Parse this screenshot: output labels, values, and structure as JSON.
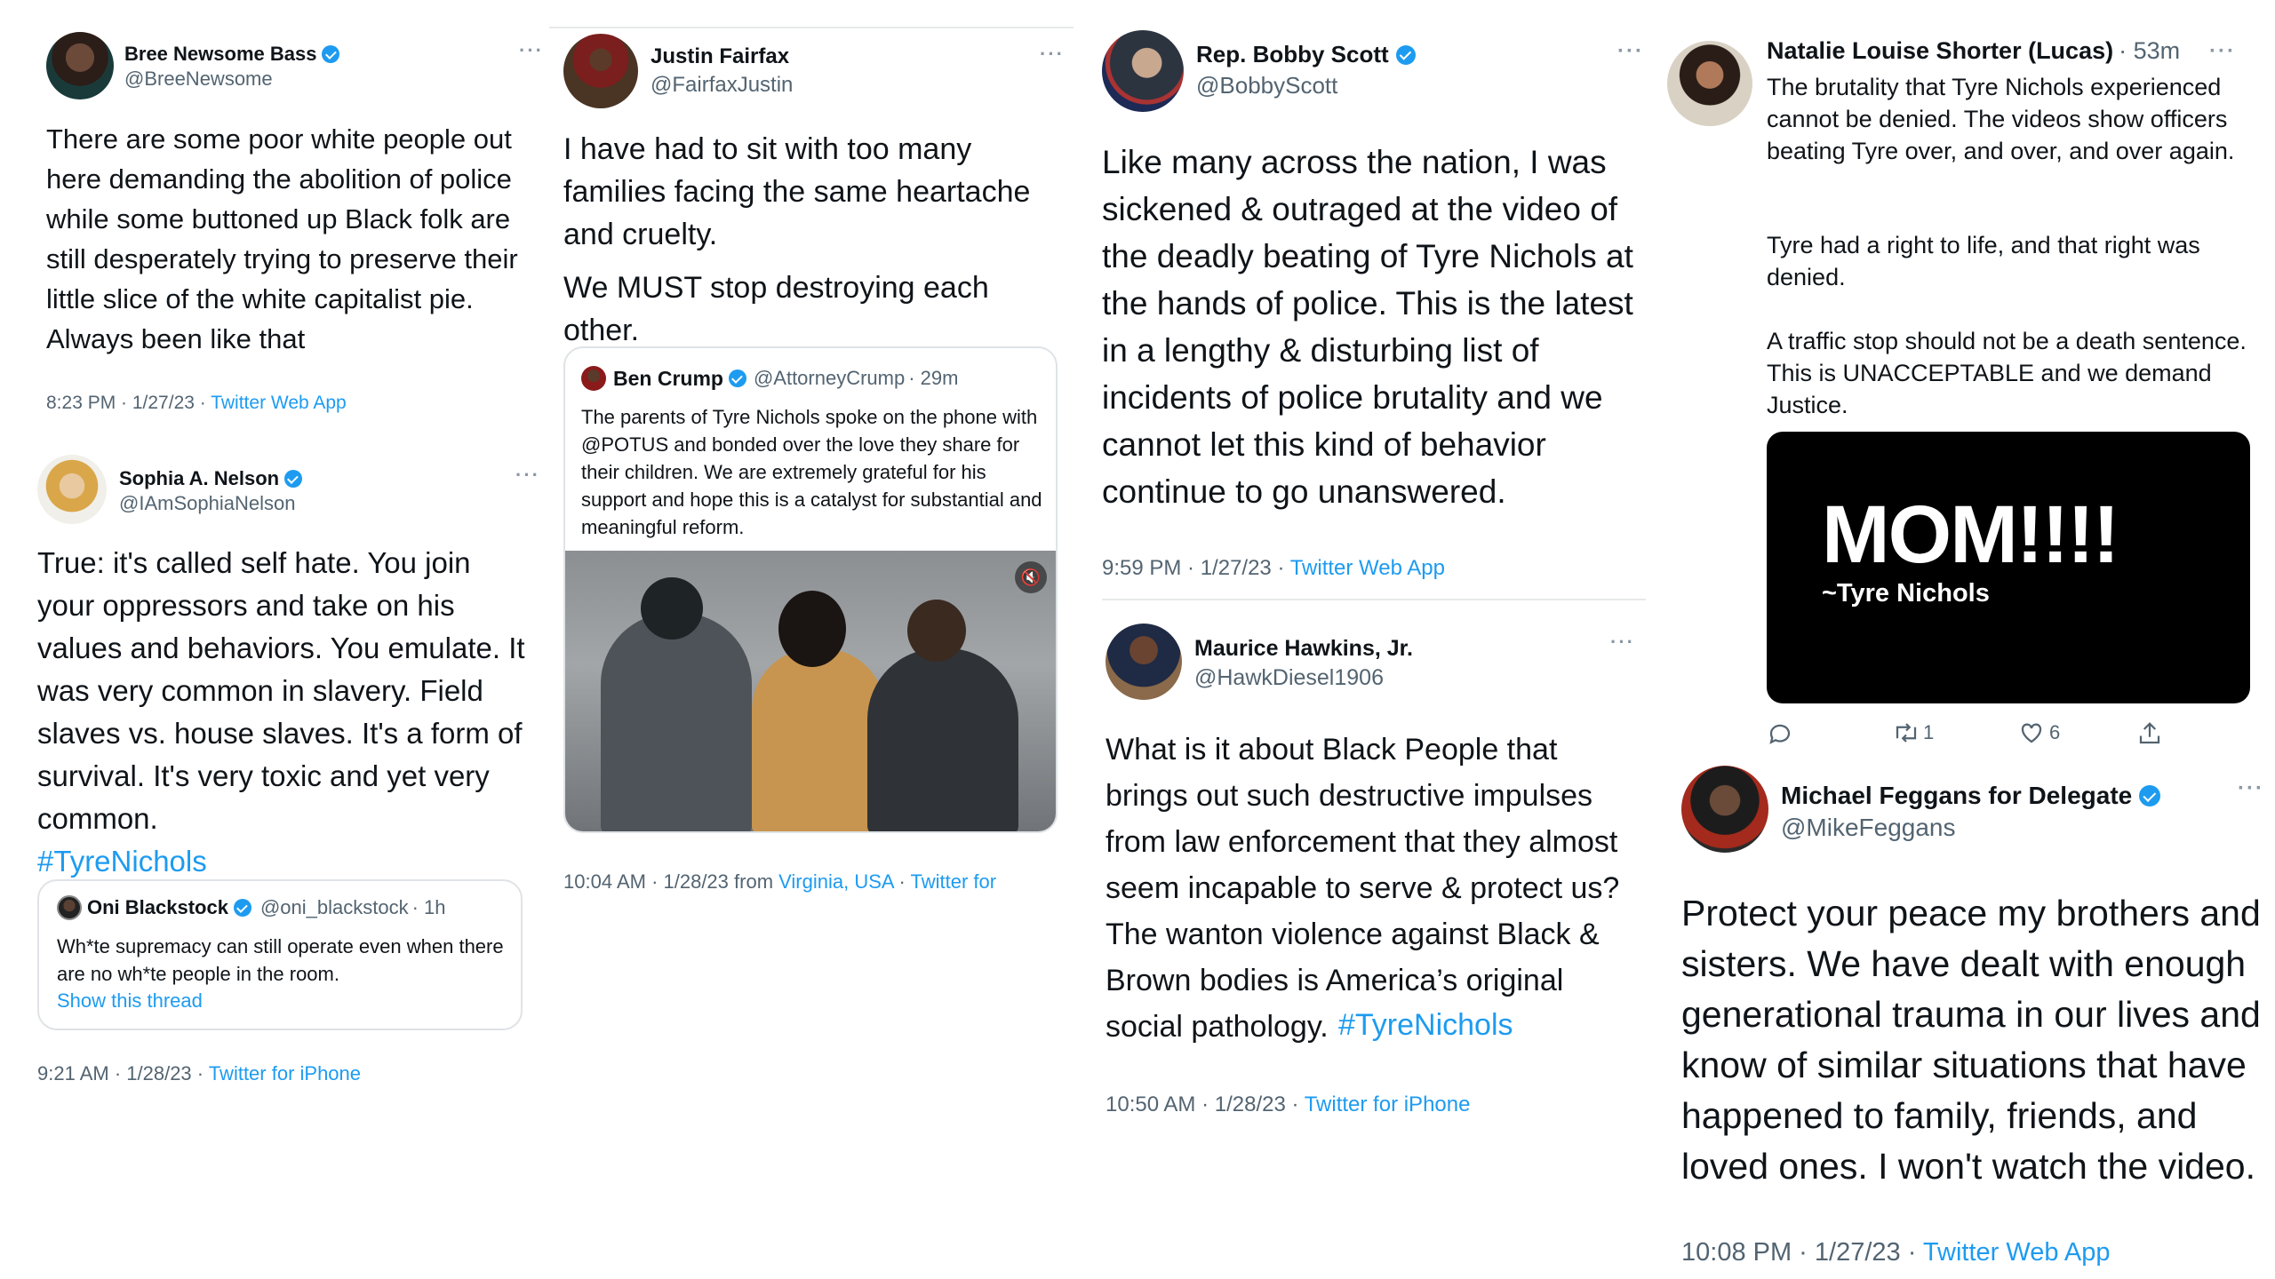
{
  "t1": {
    "name": "Bree Newsome Bass",
    "handle": "@BreeNewsome",
    "text": "There are some poor white people out here demanding the abolition of police while some buttoned up Black folk are still desperately trying to preserve their little slice of the white capitalist pie.\nAlways been like that",
    "time": "8:23 PM · 1/27/23 · ",
    "source": "Twitter Web App"
  },
  "t2": {
    "name": "Sophia A. Nelson",
    "handle": "@IAmSophiaNelson",
    "text": "True: it's called self hate. You join your oppressors and take on his values and behaviors. You emulate. It was very common in slavery. Field slaves vs. house slaves. It's a form of survival. It's very toxic and yet very common.",
    "hashtag": "#TyreNichols",
    "quote": {
      "name": "Oni Blackstock",
      "handle": "@oni_blackstock",
      "age": "· 1h",
      "text": "Wh*te supremacy can still operate even when there are no wh*te people in the room.",
      "show": "Show this thread"
    },
    "time": "9:21 AM · 1/28/23 · ",
    "source": "Twitter for iPhone"
  },
  "t3": {
    "name": "Justin Fairfax",
    "handle": "@FairfaxJustin",
    "text": "I have had to sit with too many families facing the same heartache and cruelty.",
    "text2": "We MUST stop destroying each other.",
    "quote": {
      "name": "Ben Crump",
      "handle": "@AttorneyCrump",
      "age": "· 29m",
      "text": "The parents of Tyre Nichols spoke on the phone with @POTUS and bonded over the love they share for their children. We are extremely grateful for his support and hope this is a catalyst for substantial and meaningful reform."
    },
    "time": "10:04 AM · 1/28/23 from ",
    "place": "Virginia, USA",
    "sep": " · ",
    "source": "Twitter for"
  },
  "t4": {
    "name": "Rep. Bobby Scott",
    "handle": "@BobbyScott",
    "text": "Like many across the nation, I was sickened & outraged at the video of the deadly beating of Tyre Nichols at the hands of police. This is the latest in a lengthy & disturbing list of incidents of police brutality and we cannot let this kind of behavior continue to go unanswered.",
    "time": "9:59 PM · 1/27/23 · ",
    "source": "Twitter Web App"
  },
  "t5": {
    "name": "Maurice Hawkins, Jr.",
    "handle": "@HawkDiesel1906",
    "text": "What is it about Black People that brings out such destructive impulses from law enforcement that they almost seem incapable to serve & protect us? The wanton violence against Black & Brown bodies is America’s original social pathology.",
    "hashtag": "#TyreNichols",
    "time": "10:50 AM · 1/28/23 · ",
    "source": "Twitter for iPhone"
  },
  "t6": {
    "name": "Natalie Louise Shorter (Lucas)",
    "age": "· 53m",
    "p1": "The brutality that Tyre Nichols experienced cannot be denied. The videos show officers beating Tyre over, and over, and over again.",
    "p2": "Tyre had a right to life, and that right was denied.",
    "p3": "A traffic stop should not be a death sentence. This is UNACCEPTABLE and we demand Justice.",
    "image": {
      "big": "MOM!!!!",
      "small": "~Tyre Nichols"
    },
    "retweets": "1",
    "likes": "6"
  },
  "t7": {
    "name": "Michael Feggans for Delegate",
    "handle": "@MikeFeggans",
    "text": "Protect your peace my brothers and sisters. We have dealt with enough generational trauma in our lives and know of similar situations that have happened to family, friends, and loved ones. I won't watch the video.",
    "time": "10:08 PM · 1/27/23 · ",
    "source": "Twitter Web App"
  },
  "dots": "···",
  "colors": {
    "link": "#1d9bf0",
    "verified": "#1d9bf0",
    "muted": "#536471",
    "text": "#0f1419"
  }
}
